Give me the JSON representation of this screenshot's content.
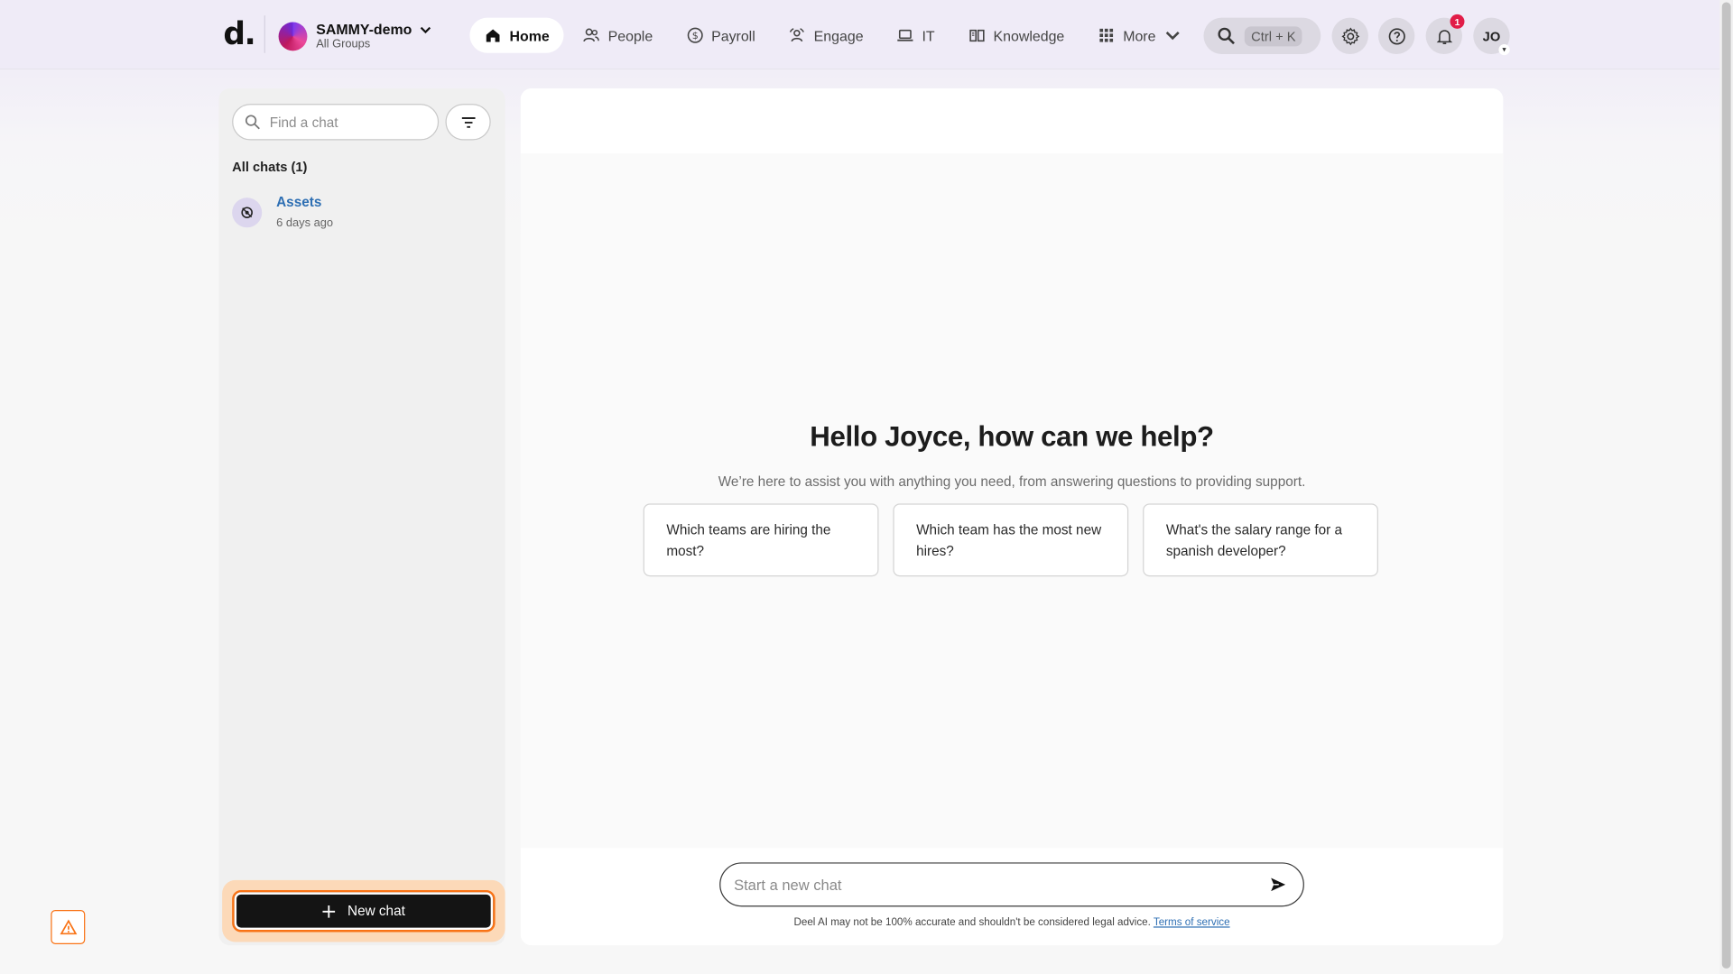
{
  "header": {
    "logo": "d.",
    "org": {
      "name": "SAMMY-demo",
      "sub": "All Groups"
    },
    "nav": [
      {
        "label": "Home",
        "icon": "home-icon",
        "active": true
      },
      {
        "label": "People",
        "icon": "people-icon"
      },
      {
        "label": "Payroll",
        "icon": "payroll-icon"
      },
      {
        "label": "Engage",
        "icon": "engage-icon"
      },
      {
        "label": "IT",
        "icon": "laptop-icon"
      },
      {
        "label": "Knowledge",
        "icon": "book-icon"
      },
      {
        "label": "More",
        "icon": "grid-icon"
      }
    ],
    "search_shortcut": "Ctrl + K",
    "notification_count": "1",
    "avatar_initials": "JO"
  },
  "sidebar": {
    "search_placeholder": "Find a chat",
    "all_chats_label": "All chats (1)",
    "chats": [
      {
        "title": "Assets",
        "time": "6 days ago"
      }
    ],
    "new_chat_label": "New chat"
  },
  "main": {
    "greeting": "Hello Joyce, how can we help?",
    "subtitle": "We’re here to assist you with anything you need, from answering questions to providing support.",
    "suggestions": [
      "Which teams are hiring the most?",
      "Which team has the most new hires?",
      "What's the salary range for a spanish developer?"
    ],
    "input_placeholder": "Start a new chat",
    "disclaimer": "Deel AI may not be 100% accurate and shouldn't be considered legal advice.",
    "terms_link": "Terms of service"
  },
  "colors": {
    "accent_orange": "#f97316",
    "link_blue": "#2e6fb3",
    "badge_red": "#e11d48"
  }
}
